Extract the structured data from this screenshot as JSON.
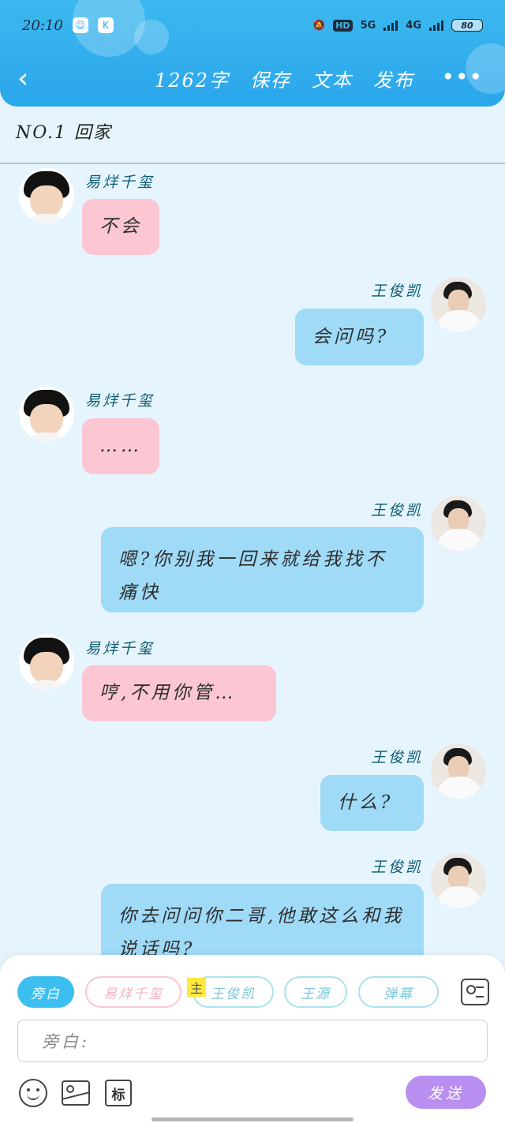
{
  "status_bar": {
    "time": "20:10",
    "network_5g": "5G",
    "network_4g": "4G",
    "hd": "HD",
    "battery": "80"
  },
  "header": {
    "word_count": "1262字",
    "save_label": "保存",
    "text_label": "文本",
    "publish_label": "发布",
    "more_label": "•••",
    "back_label": "‹"
  },
  "chapter": {
    "title": "NO.1 回家"
  },
  "messages": [
    {
      "side": "left",
      "name": "易烊千玺",
      "text": "不会"
    },
    {
      "side": "right",
      "name": "王俊凯",
      "text": "会问吗?"
    },
    {
      "side": "left",
      "name": "易烊千玺",
      "text": "……"
    },
    {
      "side": "right",
      "name": "王俊凯",
      "text": "嗯?你别我一回来就给我找不痛快"
    },
    {
      "side": "left",
      "name": "易烊千玺",
      "text": "哼,不用你管…"
    },
    {
      "side": "right",
      "name": "王俊凯",
      "text": "什么?"
    },
    {
      "side": "right",
      "name": "王俊凯",
      "text": "你去问问你二哥,他敢这么和我说话吗?"
    }
  ],
  "composer": {
    "roles": [
      "旁白",
      "易烊千玺",
      "王俊凯",
      "王源",
      "弹幕"
    ],
    "main_tag": "主",
    "input_placeholder": "旁白:",
    "mark_label": "标",
    "send_label": "发送"
  },
  "colors": {
    "header_blue": "#2aa6ec",
    "left_bubble": "#fcc6d3",
    "right_bubble": "#9fdaf7",
    "send_purple": "#b88ff0",
    "background": "#e6f5fd"
  }
}
